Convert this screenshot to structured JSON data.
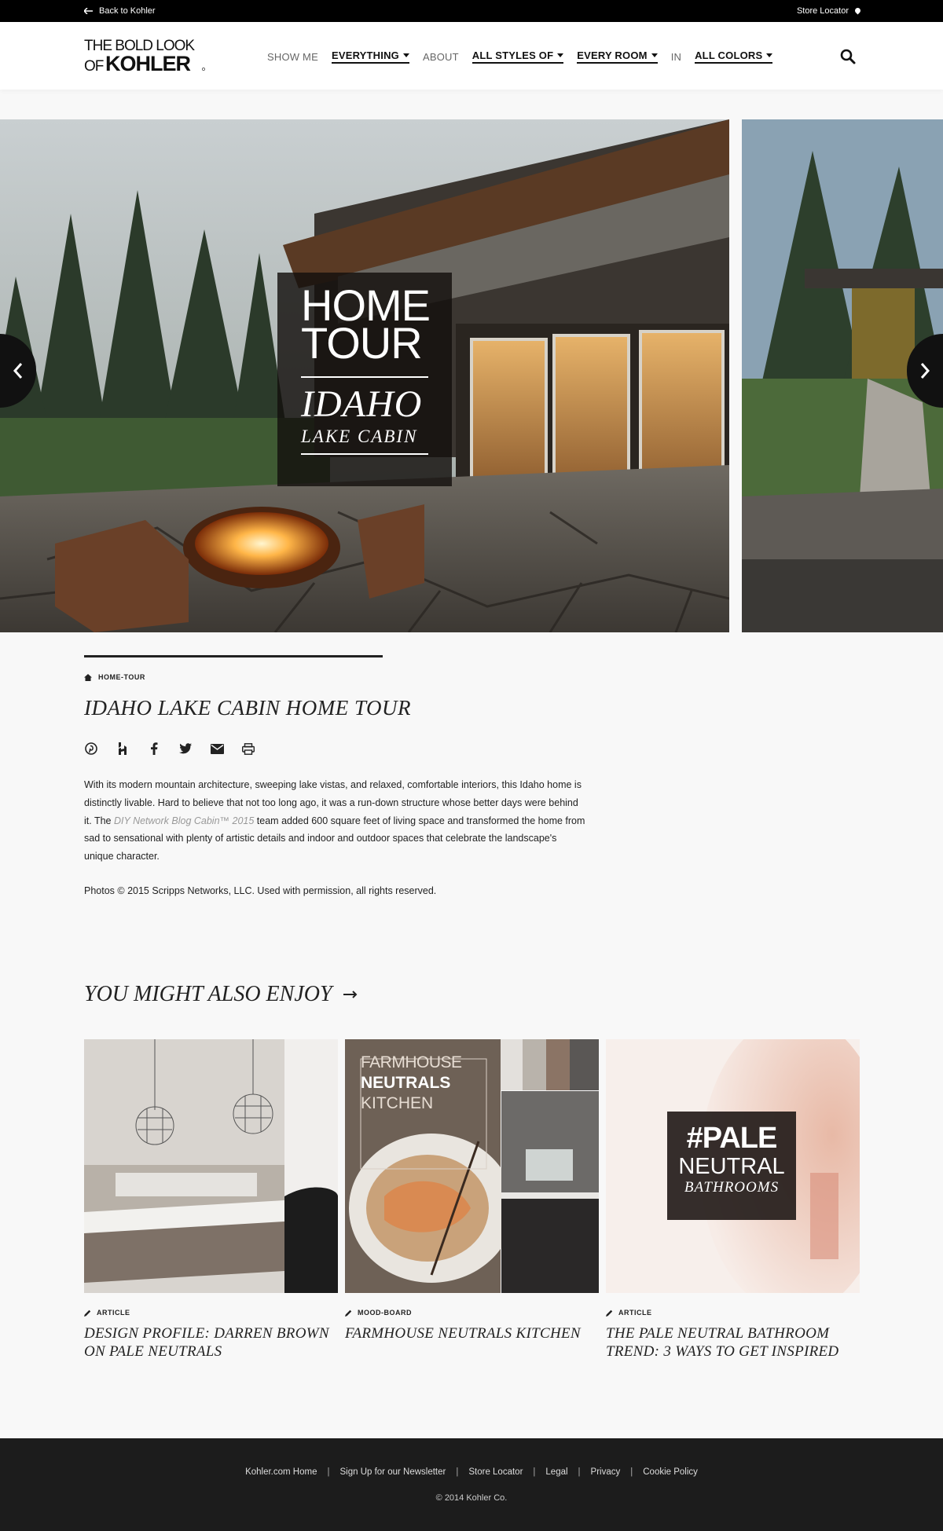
{
  "utility": {
    "back_label": "Back to Kohler",
    "store_locator_label": "Store Locator"
  },
  "header": {
    "logo_line1": "THE BOLD LOOK",
    "logo_of": "OF",
    "logo_brand": "KOHLER",
    "nav": {
      "show_me": "SHOW ME",
      "everything": "EVERYTHING",
      "about": "ABOUT",
      "all_styles": "ALL STYLES OF",
      "every_room": "EVERY ROOM",
      "in": "IN",
      "all_colors": "ALL COLORS"
    }
  },
  "hero": {
    "line1": "HOME",
    "line2": "TOUR",
    "line3": "IDAHO",
    "line4": "LAKE CABIN"
  },
  "article": {
    "category": "HOME-TOUR",
    "title": "IDAHO LAKE CABIN HOME TOUR",
    "body_part1": "With its modern mountain architecture, sweeping lake vistas, and relaxed, comfortable interiors, this Idaho home is distinctly livable. Hard to believe that not too long ago, it was a run-down structure whose better days were behind it. The ",
    "body_link": "DIY Network Blog Cabin™ 2015",
    "body_part2": " team added 600 square feet of living space and transformed the home from sad to sensational with plenty of artistic details and indoor and outdoor spaces that celebrate the landscape's unique character.",
    "credit": "Photos © 2015 Scripps Networks, LLC. Used with permission, all rights reserved."
  },
  "related": {
    "heading": "YOU MIGHT ALSO ENJOY",
    "cards": [
      {
        "type": "ARTICLE",
        "title": "DESIGN PROFILE: DARREN BROWN ON PALE NEUTRALS"
      },
      {
        "type": "MOOD-BOARD",
        "title": "FARMHOUSE NEUTRALS KITCHEN",
        "thumb_l1": "FARMHOUSE",
        "thumb_l2": "NEUTRALS",
        "thumb_l3": "KITCHEN"
      },
      {
        "type": "ARTICLE",
        "title": "THE PALE NEUTRAL BATHROOM TREND: 3 WAYS TO GET INSPIRED",
        "thumb_l1": "#PALE",
        "thumb_l2": "NEUTRAL",
        "thumb_l3": "BATHROOMS"
      }
    ]
  },
  "footer": {
    "links": [
      "Kohler.com Home",
      "Sign Up for our Newsletter",
      "Store Locator",
      "Legal",
      "Privacy",
      "Cookie Policy"
    ],
    "copyright": "© 2014 Kohler Co."
  },
  "icons": {
    "back": "arrow-left-icon",
    "locator": "map-pin-icon",
    "search": "search-icon",
    "category": "home-icon",
    "share": [
      "pinterest-icon",
      "houzz-icon",
      "facebook-icon",
      "twitter-icon",
      "email-icon",
      "print-icon"
    ],
    "card_type": "pencil-icon"
  }
}
